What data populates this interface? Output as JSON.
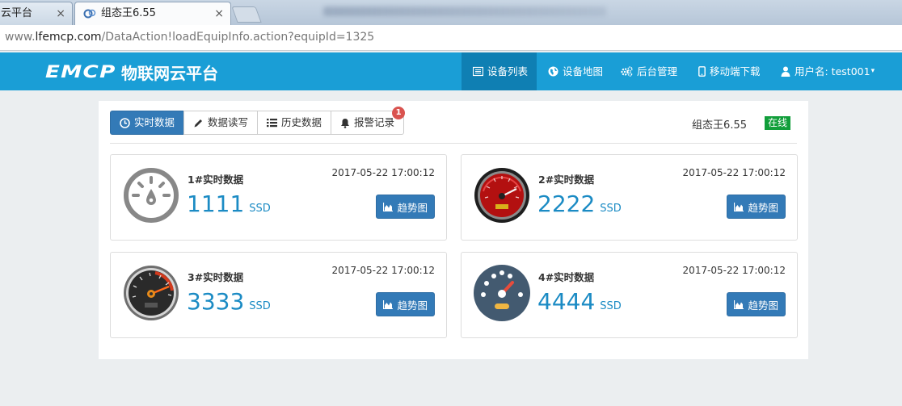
{
  "browser": {
    "tabs": [
      {
        "label": "云平台",
        "close": "×"
      },
      {
        "label": "组态王6.55",
        "close": "×"
      }
    ],
    "url_prefix": "www.",
    "url_domain": "lfemcp.com",
    "url_path": "/DataAction!loadEquipInfo.action?equipId=1325"
  },
  "navbar": {
    "logo_word": "EMCP",
    "logo_cn": "物联网云平台",
    "items": [
      {
        "label": "设备列表",
        "icon": "list-icon"
      },
      {
        "label": "设备地图",
        "icon": "globe-icon"
      },
      {
        "label": "后台管理",
        "icon": "gears-icon"
      },
      {
        "label": "移动端下载",
        "icon": "mobile-icon"
      },
      {
        "label": "用户名: test001",
        "icon": "user-icon",
        "caret": "▾"
      }
    ]
  },
  "toolbar": {
    "tabs": [
      {
        "label": "实时数据",
        "icon": "clock-icon"
      },
      {
        "label": "数据读写",
        "icon": "pencil-icon"
      },
      {
        "label": "历史数据",
        "icon": "list-icon"
      },
      {
        "label": "报警记录",
        "icon": "bell-icon"
      }
    ],
    "alarm_badge": "1",
    "device_name": "组态王6.55",
    "status": "在线"
  },
  "cards": [
    {
      "title": "1#实时数据",
      "time": "2017-05-22 17:00:12",
      "value": "1111",
      "unit": "SSD",
      "button": "趋势图"
    },
    {
      "title": "2#实时数据",
      "time": "2017-05-22 17:00:12",
      "value": "2222",
      "unit": "SSD",
      "button": "趋势图"
    },
    {
      "title": "3#实时数据",
      "time": "2017-05-22 17:00:12",
      "value": "3333",
      "unit": "SSD",
      "button": "趋势图"
    },
    {
      "title": "4#实时数据",
      "time": "2017-05-22 17:00:12",
      "value": "4444",
      "unit": "SSD",
      "button": "趋势图"
    }
  ],
  "colors": {
    "navbar": "#1a9ed6",
    "navbar_active": "#0f7fb3",
    "primary": "#337ab7",
    "value": "#1b8bc4",
    "online": "#119e3a",
    "badge": "#d9534f"
  }
}
